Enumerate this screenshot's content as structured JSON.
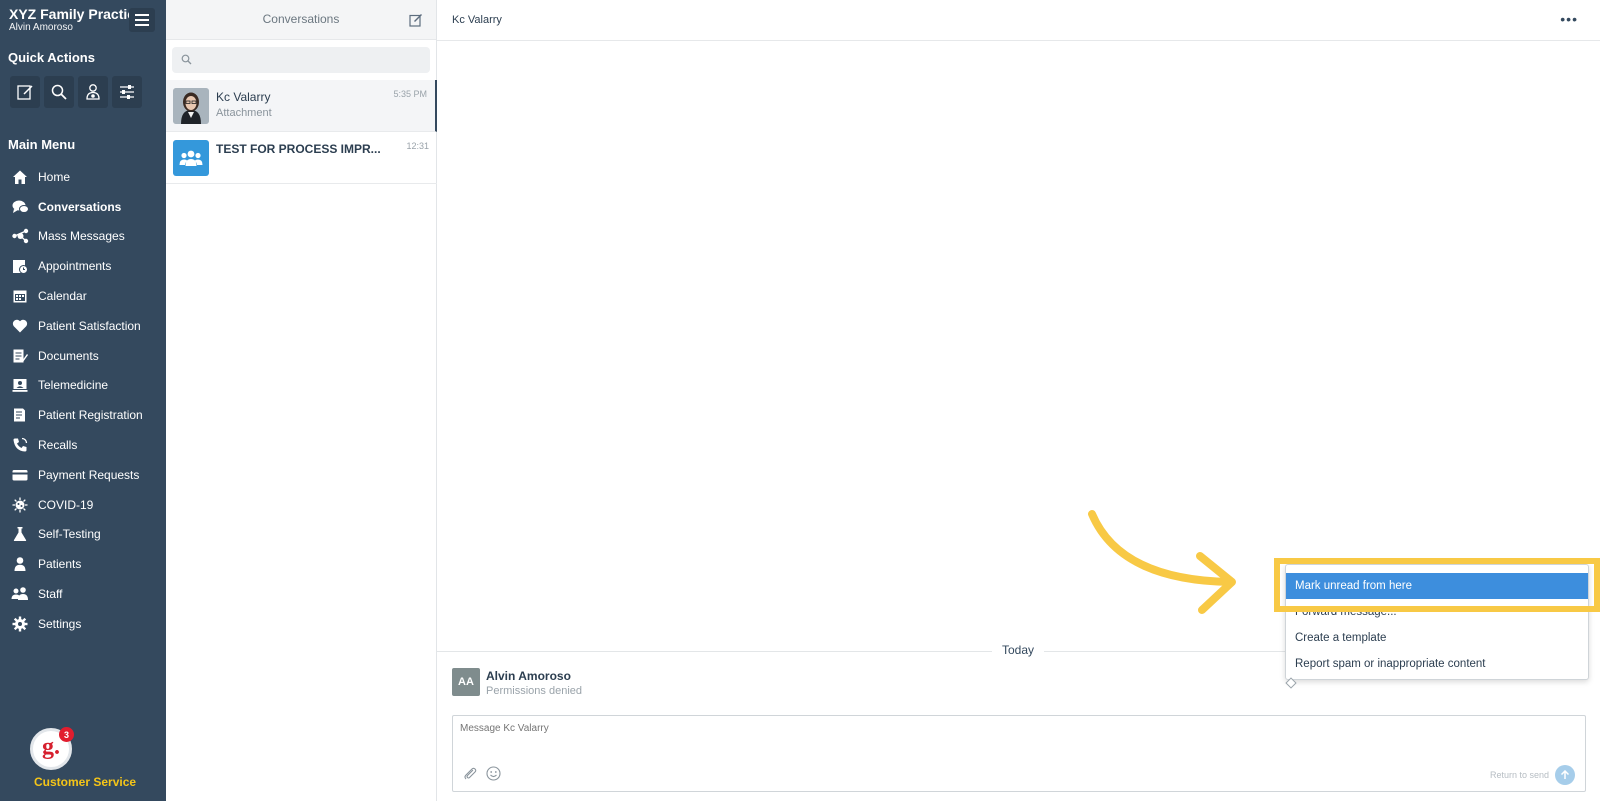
{
  "sidebar": {
    "practice_name": "XYZ Family Practice",
    "user_name": "Alvin Amoroso",
    "quick_actions_title": "Quick Actions",
    "quick_actions": [
      {
        "icon": "compose-icon"
      },
      {
        "icon": "search-icon"
      },
      {
        "icon": "add-patient-icon"
      },
      {
        "icon": "filters-icon"
      }
    ],
    "main_menu_title": "Main Menu",
    "items": [
      {
        "label": "Home",
        "icon": "home-icon"
      },
      {
        "label": "Conversations",
        "icon": "chat-icon",
        "active": true
      },
      {
        "label": "Mass Messages",
        "icon": "mass-messages-icon"
      },
      {
        "label": "Appointments",
        "icon": "appointments-icon"
      },
      {
        "label": "Calendar",
        "icon": "calendar-icon"
      },
      {
        "label": "Patient Satisfaction",
        "icon": "heart-icon"
      },
      {
        "label": "Documents",
        "icon": "documents-icon"
      },
      {
        "label": "Telemedicine",
        "icon": "telemedicine-icon"
      },
      {
        "label": "Patient Registration",
        "icon": "registration-icon"
      },
      {
        "label": "Recalls",
        "icon": "phone-icon"
      },
      {
        "label": "Payment Requests",
        "icon": "credit-card-icon"
      },
      {
        "label": "COVID-19",
        "icon": "virus-icon"
      },
      {
        "label": "Self-Testing",
        "icon": "flask-icon"
      },
      {
        "label": "Patients",
        "icon": "person-icon"
      },
      {
        "label": "Staff",
        "icon": "group-icon"
      },
      {
        "label": "Settings",
        "icon": "gear-icon"
      }
    ],
    "customer_service": {
      "label": "Customer Service",
      "badge": "3",
      "logo_text": "g."
    }
  },
  "conversations": {
    "title": "Conversations",
    "search_placeholder": "",
    "items": [
      {
        "name": "Kc Valarry",
        "preview": "Attachment",
        "time": "5:35 PM",
        "selected": true
      },
      {
        "name": "TEST FOR PROCESS IMPR...",
        "preview": "",
        "time": "12:31",
        "selected": false
      }
    ]
  },
  "chat": {
    "title": "Kc Valarry",
    "day_label": "Today",
    "message": {
      "avatar_initials": "AA",
      "sender": "Alvin Amoroso",
      "text": "Permissions denied"
    },
    "composer_placeholder": "Message Kc Valarry",
    "return_hint": "Return to send"
  },
  "context_menu": {
    "items": [
      {
        "label": "Mark unread from here",
        "highlighted": true
      },
      {
        "label": "Forward message...",
        "highlighted": false
      },
      {
        "label": "Create a template",
        "highlighted": false
      },
      {
        "label": "Report spam or inappropriate content",
        "highlighted": false
      }
    ]
  },
  "colors": {
    "sidebar_bg": "#34495e",
    "highlight_blue": "#3d8edd",
    "tutorial_yellow": "#f8c945",
    "customer_service_yellow": "#f5c518"
  }
}
